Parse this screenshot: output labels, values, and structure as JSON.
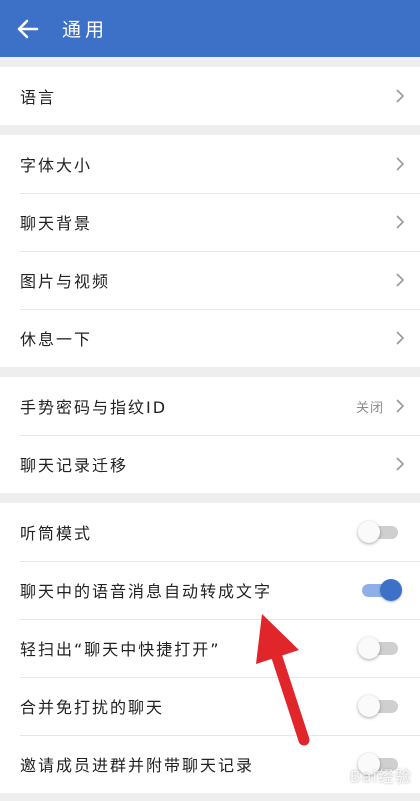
{
  "header": {
    "title": "通用",
    "back_icon": "arrow-left-icon",
    "color": "#3d71c7"
  },
  "groups": [
    {
      "items": [
        {
          "label": "语言",
          "type": "nav"
        }
      ]
    },
    {
      "items": [
        {
          "label": "字体大小",
          "type": "nav"
        },
        {
          "label": "聊天背景",
          "type": "nav"
        },
        {
          "label": "图片与视频",
          "type": "nav"
        },
        {
          "label": "休息一下",
          "type": "nav"
        }
      ]
    },
    {
      "items": [
        {
          "label": "手势密码与指纹ID",
          "type": "nav",
          "value": "关闭"
        },
        {
          "label": "聊天记录迁移",
          "type": "nav"
        }
      ]
    },
    {
      "items": [
        {
          "label": "听筒模式",
          "type": "toggle",
          "on": false
        },
        {
          "label": "聊天中的语音消息自动转成文字",
          "type": "toggle",
          "on": true
        },
        {
          "label": "轻扫出“聊天中快捷打开”",
          "type": "toggle",
          "on": false
        },
        {
          "label": "合并免打扰的聊天",
          "type": "toggle",
          "on": false
        },
        {
          "label": "邀请成员进群并附带聊天记录",
          "type": "toggle",
          "on": false
        }
      ]
    }
  ],
  "annotation": {
    "type": "red-arrow",
    "points_to": "聊天中的语音消息自动转成文字",
    "color": "#e0262b"
  },
  "watermark": {
    "text": "Bai经验"
  },
  "colors": {
    "toggle_on": "#3d71c7",
    "toggle_off_track": "#cfcfcf"
  }
}
